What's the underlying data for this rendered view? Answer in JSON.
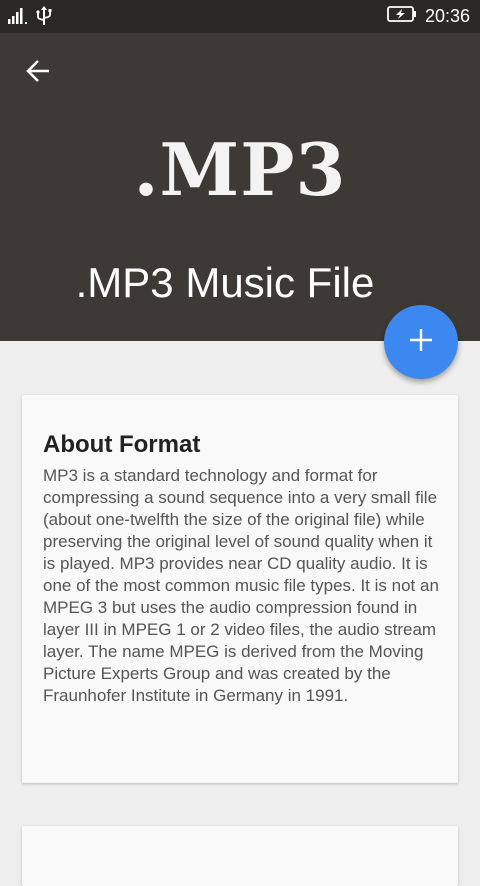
{
  "status_bar": {
    "time": "20:36",
    "signal_icon": "signal-bars-icon",
    "usb_icon": "usb-icon",
    "battery_icon": "battery-charging-icon"
  },
  "header": {
    "back_icon": "arrow-left-icon",
    "extension_logo": ".MP3",
    "title": ".MP3 Music File",
    "background": "#3d3a35"
  },
  "fab": {
    "icon": "plus-icon",
    "color": "#3d87f0"
  },
  "about": {
    "title": "About Format",
    "body": "MP3 is a standard technology and format for compressing a sound sequence into a very small file (about one-twelfth the size of the original file) while preserving the original level of sound quality when it is played. MP3 provides near CD quality audio. It is one of the most common music file types. It is not an MPEG 3 but uses the audio compression found in layer III in MPEG 1 or 2 video files, the audio stream layer. The name MPEG is derived from the Moving Picture Experts Group and was created by the Fraunhofer Institute in Germany in 1991."
  }
}
